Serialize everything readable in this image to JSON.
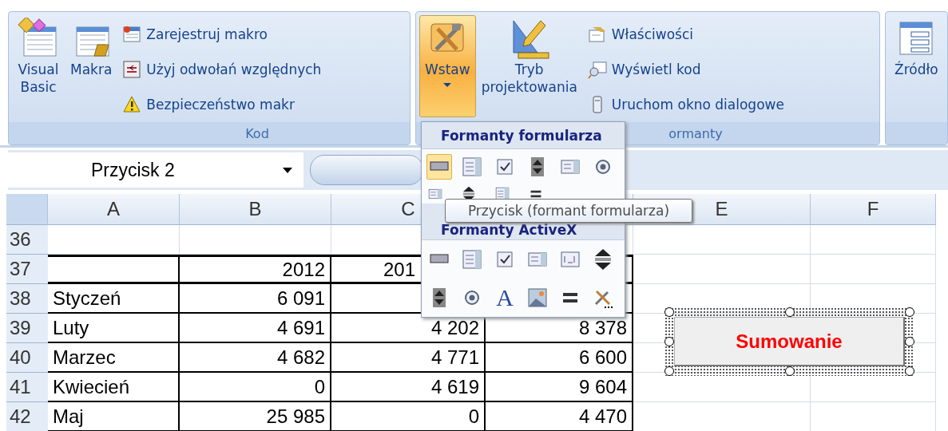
{
  "ribbon": {
    "groups": [
      {
        "label": "Kod",
        "large_buttons": [
          {
            "label": "Visual Basic",
            "selected": false,
            "dropdown": false
          },
          {
            "label": "Makra",
            "selected": false,
            "dropdown": false
          }
        ],
        "small_buttons": [
          {
            "label": "Zarejestruj makro"
          },
          {
            "label": "Użyj odwołań względnych"
          },
          {
            "label": "Bezpieczeństwo makr"
          }
        ]
      },
      {
        "label": "ormanty",
        "large_buttons": [
          {
            "label": "Wstaw",
            "selected": true,
            "dropdown": true
          },
          {
            "label": "Tryb projektowania",
            "selected": false,
            "dropdown": false
          }
        ],
        "small_buttons": [
          {
            "label": "Właściwości"
          },
          {
            "label": "Wyświetl kod"
          },
          {
            "label": "Uruchom okno dialogowe"
          }
        ]
      },
      {
        "large_buttons": [
          {
            "label": "Źródło",
            "selected": false,
            "dropdown": false
          }
        ]
      }
    ]
  },
  "name_box": {
    "value": "Przycisk 2"
  },
  "sheet": {
    "columns": [
      {
        "label": "A"
      },
      {
        "label": "B"
      },
      {
        "label": "C"
      },
      {},
      {
        "label": "E"
      },
      {
        "label": "F"
      }
    ],
    "rows": [
      {
        "number": "36",
        "kind": "plain",
        "cells": [
          {},
          {},
          {},
          {},
          {},
          {}
        ]
      },
      {
        "number": "37",
        "kind": "table-head",
        "cells": [
          {},
          {
            "text": "2012"
          },
          {
            "text": "201",
            "cut": true
          },
          {},
          {},
          {}
        ]
      },
      {
        "number": "38",
        "kind": "table",
        "cells": [
          {
            "text": "Styczeń"
          },
          {
            "text": "6 091"
          },
          {},
          {},
          {},
          {}
        ]
      },
      {
        "number": "39",
        "kind": "table",
        "cells": [
          {
            "text": "Luty"
          },
          {
            "text": "4 691"
          },
          {
            "text": "4 202"
          },
          {
            "text": "8 378"
          },
          {},
          {}
        ]
      },
      {
        "number": "40",
        "kind": "table",
        "cells": [
          {
            "text": "Marzec"
          },
          {
            "text": "4 682"
          },
          {
            "text": "4 771"
          },
          {
            "text": "6 600"
          },
          {},
          {}
        ]
      },
      {
        "number": "41",
        "kind": "table",
        "cells": [
          {
            "text": "Kwiecień"
          },
          {
            "text": "0"
          },
          {
            "text": "4 619"
          },
          {
            "text": "9 604"
          },
          {},
          {}
        ]
      },
      {
        "number": "42",
        "kind": "table",
        "cells": [
          {
            "text": "Maj"
          },
          {
            "text": "25 985"
          },
          {
            "text": "0"
          },
          {
            "text": "4 470"
          },
          {},
          {}
        ]
      }
    ]
  },
  "insert_menu": {
    "form_controls": {
      "title": "Formanty formularza",
      "tools": [
        {
          "selected": true
        },
        {
          "selected": false
        },
        {
          "selected": false
        },
        {
          "selected": false
        },
        {
          "selected": false
        },
        {
          "selected": false
        }
      ]
    },
    "activex_controls": {
      "title": "Formanty ActiveX",
      "label_glyph": "A"
    }
  },
  "tooltip": {
    "text": "Przycisk (formant formularza)"
  },
  "form_button": {
    "label": "Sumowanie",
    "selected": true
  }
}
